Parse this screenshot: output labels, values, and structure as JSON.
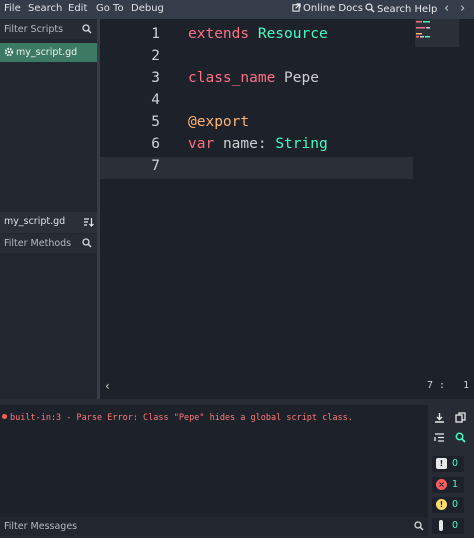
{
  "menu": [
    "File",
    "Search",
    "Edit",
    "Go To",
    "Debug"
  ],
  "toplinks": {
    "online_docs": "Online Docs",
    "search_help": "Search Help"
  },
  "nav": {
    "back": "‹",
    "forward": "›"
  },
  "scripts_panel": {
    "filter_placeholder": "Filter Scripts",
    "items": [
      "my_script.gd"
    ],
    "current_script": "my_script.gd",
    "methods_filter_placeholder": "Filter Methods"
  },
  "editor": {
    "line_numbers": [
      "1",
      "2",
      "3",
      "4",
      "5",
      "6",
      "7"
    ],
    "code": {
      "l1_kw": "extends",
      "l1_type": "Resource",
      "l3_kw": "class_name",
      "l3_name": "Pepe",
      "l5_annotation": "@export",
      "l6_kw": "var",
      "l6_name": "name:",
      "l6_type": "String"
    },
    "status_left": "‹",
    "cursor": "7 :   1"
  },
  "output": {
    "error": "built-in:3 - Parse Error: Class \"Pepe\" hides a global script class.",
    "filter_placeholder": "Filter Messages",
    "counts": {
      "errors": "0",
      "error_msgs": "1",
      "warnings": "0",
      "messages": "0"
    }
  },
  "colors": {
    "accent": "#42ffc2",
    "keyword": "#ff7085",
    "annotation": "#ffb373",
    "error": "#ff7a7a",
    "selection": "#3d7a64"
  }
}
